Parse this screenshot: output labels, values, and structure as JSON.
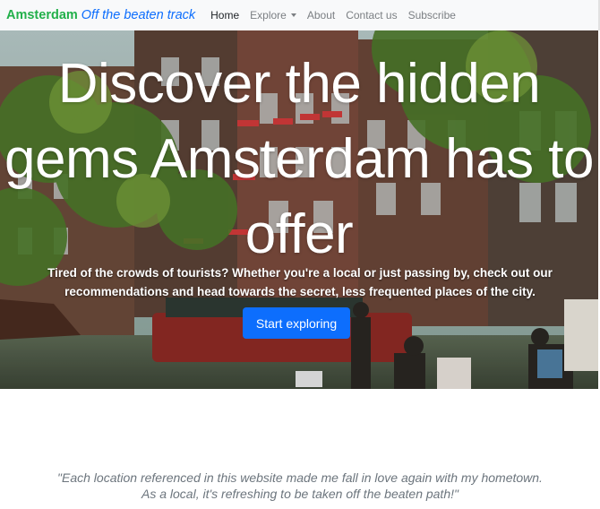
{
  "navbar": {
    "brand_main": "Amsterdam",
    "brand_sub": "Off the beaten track",
    "links": [
      {
        "label": "Home"
      },
      {
        "label": "Explore"
      },
      {
        "label": "About"
      },
      {
        "label": "Contact us"
      },
      {
        "label": "Subscribe"
      }
    ]
  },
  "hero": {
    "title": "Discover the hidden gems Amsterdam has to offer",
    "subtitle": "Tired of the crowds of tourists? Whether you're a local or just passing by, check out our recommendations and head towards the secret, less frequented places of the city.",
    "cta_label": "Start exploring"
  },
  "testimonial": {
    "text": "\"Each location referenced in this website made me fall in love again with my hometown. As a local, it's refreshing to be taken off the beaten path!\""
  },
  "colors": {
    "brand_green": "#22b04a",
    "brand_blue": "#0d6efd",
    "navbar_bg": "#f8f9fa",
    "button_primary": "#0d6efd"
  },
  "icons": {
    "dropdown": "chevron-down-icon"
  }
}
